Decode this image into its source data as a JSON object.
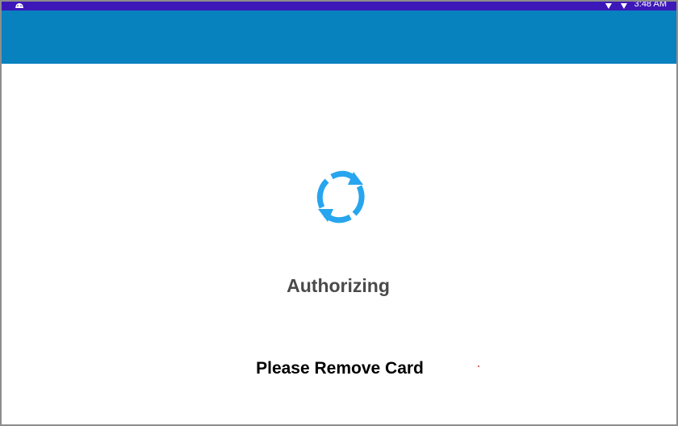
{
  "status_bar": {
    "time": "3:48 AM",
    "left_icon": "android-notification-icon",
    "right_icons": [
      "wifi-icon",
      "signal-icon"
    ],
    "color": "#3d18b8"
  },
  "app_bar": {
    "color": "#0881bf"
  },
  "content": {
    "spinner_icon": "refresh-icon",
    "status": "Authorizing",
    "instruction": "Please Remove Card"
  },
  "colors": {
    "frame_border": "#8d8d8d",
    "spinner": "#27a5ef",
    "status_text": "#4a4a4a",
    "instruction_text": "#000000"
  }
}
